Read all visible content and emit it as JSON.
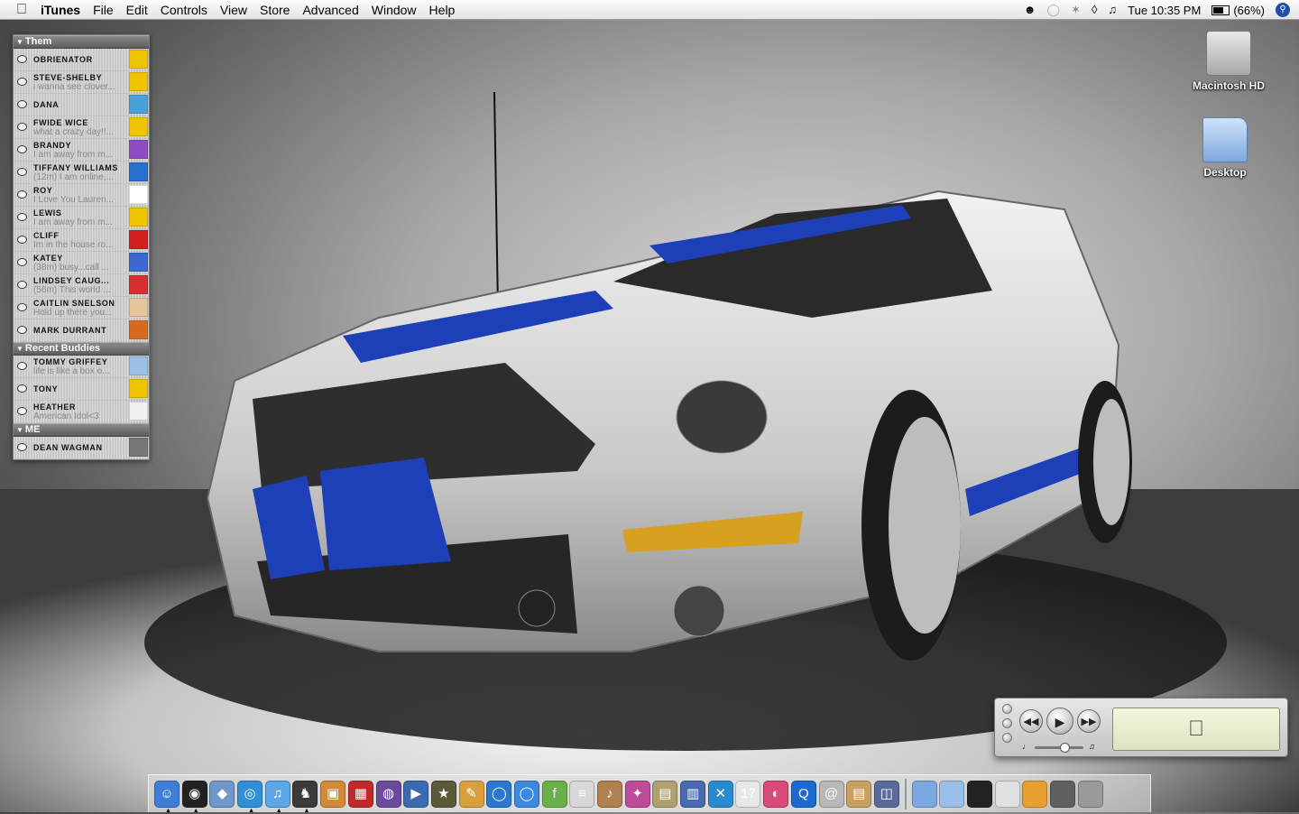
{
  "menubar": {
    "apple_icon": "apple-logo-icon",
    "menus": [
      "iTunes",
      "File",
      "Edit",
      "Controls",
      "View",
      "Store",
      "Advanced",
      "Window",
      "Help"
    ],
    "clock": "Tue 10:35 PM",
    "battery": "(66%)",
    "battery_level": 0.66,
    "extras_icons": [
      "ichat-status-icon",
      "speech-bubble-icon",
      "bluetooth-icon",
      "wifi-icon",
      "volume-icon",
      "spotlight-icon"
    ]
  },
  "buddylist": {
    "groups": [
      {
        "name": "Them",
        "buddies": [
          {
            "name": "Obrienator",
            "status": "",
            "icon": "aim-running-man-icon",
            "icon_color": "#f0c400"
          },
          {
            "name": "Steve-Shelby",
            "status": "i wanna see clover...",
            "icon": "aim-running-man-icon",
            "icon_color": "#f0c400"
          },
          {
            "name": "Dana",
            "status": "",
            "icon": "buddy-avatar-icon",
            "icon_color": "#4aa0d8"
          },
          {
            "name": "Fwide Wice",
            "status": "what a crazy day!!...",
            "icon": "aim-running-man-icon",
            "icon_color": "#f0c400"
          },
          {
            "name": "Brandy",
            "status": "I am away from m...",
            "icon": "buddy-avatar-icon",
            "icon_color": "#8c4cc4"
          },
          {
            "name": "Tiffany Williams",
            "status": "(12m) I am online,...",
            "icon": "aim-logo-icon",
            "icon_color": "#2a6fd0"
          },
          {
            "name": "Roy",
            "status": "I Love You Lauren...",
            "icon": "blank-avatar-icon",
            "icon_color": "#ffffff"
          },
          {
            "name": "Lewis",
            "status": "I am away from m...",
            "icon": "aim-running-man-icon",
            "icon_color": "#f0c400"
          },
          {
            "name": "Cliff",
            "status": "Im in the house ro...",
            "icon": "buddy-avatar-icon",
            "icon_color": "#d02020"
          },
          {
            "name": "Katey",
            "status": "(38m) busy...call ...",
            "icon": "buddy-avatar-icon",
            "icon_color": "#3a6ad0"
          },
          {
            "name": "Lindsey Caug...",
            "status": "(56m) This world ...",
            "icon": "buddy-avatar-icon",
            "icon_color": "#d83030"
          },
          {
            "name": "Caitlin Snelson",
            "status": "Hold up there you...",
            "icon": "buddy-avatar-icon",
            "icon_color": "#e8c49a"
          },
          {
            "name": "Mark Durrant",
            "status": "",
            "icon": "basketball-icon",
            "icon_color": "#d86a20"
          }
        ]
      },
      {
        "name": "Recent Buddies",
        "buddies": [
          {
            "name": "Tommy Griffey",
            "status": "life is like a box o...",
            "icon": "buddy-avatar-icon",
            "icon_color": "#9ac0e8"
          },
          {
            "name": "tony",
            "status": "",
            "icon": "fish-icon",
            "icon_color": "#f0c400"
          },
          {
            "name": "Heather",
            "status": "American Idol<3",
            "icon": "buddy-avatar-icon",
            "icon_color": "#f0f0f0"
          }
        ]
      },
      {
        "name": "ME",
        "buddies": [
          {
            "name": "Dean Wagman",
            "status": "",
            "icon": "buddy-photo-icon",
            "icon_color": "#777777"
          }
        ]
      }
    ]
  },
  "desktop": {
    "icons": [
      {
        "label": "Macintosh HD",
        "icon": "hard-drive-icon"
      },
      {
        "label": "Desktop",
        "icon": "folder-icon"
      }
    ]
  },
  "miniplayer": {
    "lcd_icon": "apple-logo-icon",
    "volume_level": 0.55,
    "buttons": [
      "previous-button",
      "play-button",
      "next-button"
    ]
  },
  "dock": {
    "apps": [
      {
        "name": "finder",
        "color": "#3d7fd8",
        "running": true
      },
      {
        "name": "front-row",
        "color": "#222222",
        "running": true
      },
      {
        "name": "preview",
        "color": "#6f98c9",
        "running": false
      },
      {
        "name": "safari",
        "color": "#2f8fd8",
        "running": true
      },
      {
        "name": "itunes",
        "color": "#5aa6e6",
        "running": true
      },
      {
        "name": "adium",
        "color": "#3a3a3a",
        "running": true
      },
      {
        "name": "iphoto",
        "color": "#d28a3a",
        "running": false
      },
      {
        "name": "photo-booth",
        "color": "#c02a2a",
        "running": false
      },
      {
        "name": "dvd-player",
        "color": "#6a4a9a",
        "running": false
      },
      {
        "name": "imovie",
        "color": "#3a6ab0",
        "running": false
      },
      {
        "name": "imovie-star",
        "color": "#5a5a3a",
        "running": false
      },
      {
        "name": "iweb",
        "color": "#d8a03a",
        "running": false
      },
      {
        "name": "ichat",
        "color": "#2a78d0",
        "running": false
      },
      {
        "name": "ichat-av",
        "color": "#3a8ae0",
        "running": false
      },
      {
        "name": "font-book",
        "color": "#6ab04a",
        "running": false
      },
      {
        "name": "textedit",
        "color": "#d8d8d8",
        "running": false
      },
      {
        "name": "garageband",
        "color": "#b08050",
        "running": false
      },
      {
        "name": "iwork",
        "color": "#c04a9a",
        "running": false
      },
      {
        "name": "keynote",
        "color": "#b0a070",
        "running": false
      },
      {
        "name": "system-monitor",
        "color": "#4a6ab0",
        "running": false
      },
      {
        "name": "xcode",
        "color": "#2a8ad0",
        "running": false
      },
      {
        "name": "ical",
        "color": "#e8e8e8",
        "running": false
      },
      {
        "name": "color-picker",
        "color": "#d84a7a",
        "running": false
      },
      {
        "name": "quicktime",
        "color": "#1a6ad0",
        "running": false
      },
      {
        "name": "apple-mail",
        "color": "#b8b8b8",
        "running": false
      },
      {
        "name": "address-book",
        "color": "#c8a060",
        "running": false
      },
      {
        "name": "image-capture",
        "color": "#5a6a9a",
        "running": false
      }
    ],
    "docs": [
      {
        "name": "applications-folder",
        "color": "#7aa8e0"
      },
      {
        "name": "documents-folder",
        "color": "#9ac0e8"
      },
      {
        "name": "ipod",
        "color": "#222222"
      },
      {
        "name": "disk-image",
        "color": "#e0e0e0"
      },
      {
        "name": "usb-drive",
        "color": "#e8a030"
      },
      {
        "name": "dvd-drive",
        "color": "#606060"
      },
      {
        "name": "trash",
        "color": "#9a9a9a"
      }
    ]
  }
}
